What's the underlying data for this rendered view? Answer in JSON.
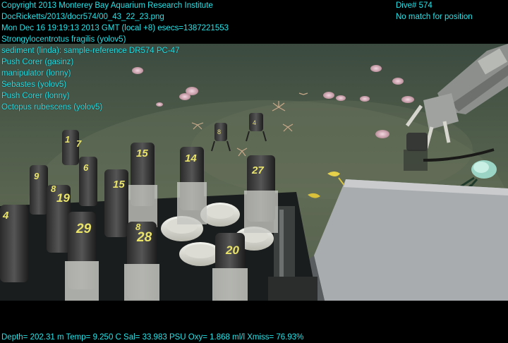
{
  "overlay_lines": [
    "Copyright 2013 Monterey Bay Aquarium Research Institute",
    "DocRicketts/2013/docr574/00_43_22_23.png",
    "Mon Dec 16 19:19:13 2013 GMT (local +8)  esecs=1387221553",
    "Strongylocentrotus fragilis (yolov5)",
    "sediment (linda): sample-reference DR574 PC-47",
    "Push Corer (gasinz)",
    "manipulator (lonny)",
    "Sebastes (yolov5)",
    "Push Corer (lonny)",
    "Octopus rubescens (yolov5)"
  ],
  "dive": "Dive# 574",
  "position_status": "No match for position",
  "telemetry": "Depth= 202.31 m  Temp= 9.250 C  Sal= 33.983 PSU  Oxy= 1.868 ml/l  Xmiss= 76.93%",
  "tube_labels": [
    "1",
    "7",
    "6",
    "15",
    "14",
    "27",
    "9",
    "19",
    "15",
    "8",
    "29",
    "28",
    "20",
    "4",
    "8"
  ],
  "colors": {
    "overlay_text": "#27e3e8",
    "background": "#000000"
  }
}
